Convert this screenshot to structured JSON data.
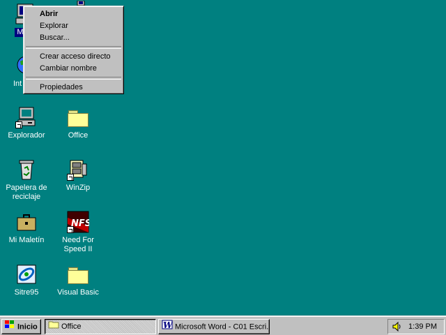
{
  "context_menu": {
    "items": [
      {
        "label": "Abrir",
        "bold": true
      },
      {
        "label": "Explorar"
      },
      {
        "label": "Buscar..."
      },
      {
        "separator": true
      },
      {
        "label": "Crear acceso directo"
      },
      {
        "label": "Cambiar nombre"
      },
      {
        "separator": true
      },
      {
        "label": "Propiedades"
      }
    ]
  },
  "desktop_icons": {
    "mi_pc": {
      "label": "M",
      "icon": "my-computer-icon"
    },
    "internet": {
      "label": "Int",
      "icon": "internet-globe-icon"
    },
    "explorador": {
      "label": "Explorador",
      "icon": "explorer-icon"
    },
    "office": {
      "label": "Office",
      "icon": "folder-icon"
    },
    "papelera": {
      "label": "Papelera de reciclaje",
      "icon": "recycle-bin-icon"
    },
    "winzip": {
      "label": "WinZip",
      "icon": "winzip-icon"
    },
    "maletin": {
      "label": "Mi Maletín",
      "icon": "briefcase-icon"
    },
    "nfs": {
      "label": "Need For Speed II",
      "icon": "nfs-icon"
    },
    "sitre": {
      "label": "Sitre95",
      "icon": "sitre-icon"
    },
    "vbasic": {
      "label": "Visual Basic",
      "icon": "folder-icon"
    }
  },
  "taskbar": {
    "start_label": "Inicio",
    "tasks": [
      {
        "label": "Office"
      },
      {
        "label": "Microsoft Word - C01 Escri..."
      }
    ],
    "clock": "1:39 PM"
  },
  "colors": {
    "desktop": "#008080",
    "face": "#c0c0c0"
  }
}
